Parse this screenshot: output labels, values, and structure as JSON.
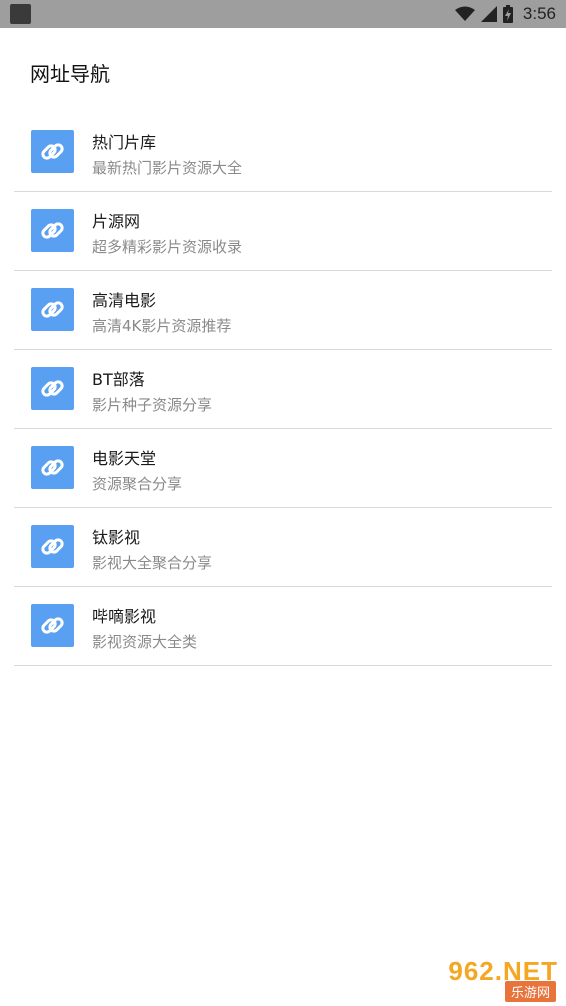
{
  "status_bar": {
    "time": "3:56",
    "icons": [
      "wifi-icon",
      "signal-icon",
      "battery-icon"
    ]
  },
  "page": {
    "title": "网址导航"
  },
  "links": [
    {
      "title": "热门片库",
      "desc": "最新热门影片资源大全",
      "icon": "link-icon"
    },
    {
      "title": "片源网",
      "desc": "超多精彩影片资源收录",
      "icon": "link-icon"
    },
    {
      "title": "高清电影",
      "desc": "高清4K影片资源推荐",
      "icon": "link-icon"
    },
    {
      "title": "BT部落",
      "desc": "影片种子资源分享",
      "icon": "link-icon"
    },
    {
      "title": "电影天堂",
      "desc": "资源聚合分享",
      "icon": "link-icon"
    },
    {
      "title": "钛影视",
      "desc": "影视大全聚合分享",
      "icon": "link-icon"
    },
    {
      "title": "哔嘀影视",
      "desc": "影视资源大全类",
      "icon": "link-icon"
    }
  ],
  "watermark": {
    "top": "962.NET",
    "bottom": "乐游网"
  },
  "colors": {
    "status_bar": "#9e9e9e",
    "icon_bg": "#5aa0f2",
    "divider": "#d9d9d9",
    "desc_text": "#8a8a8a"
  }
}
